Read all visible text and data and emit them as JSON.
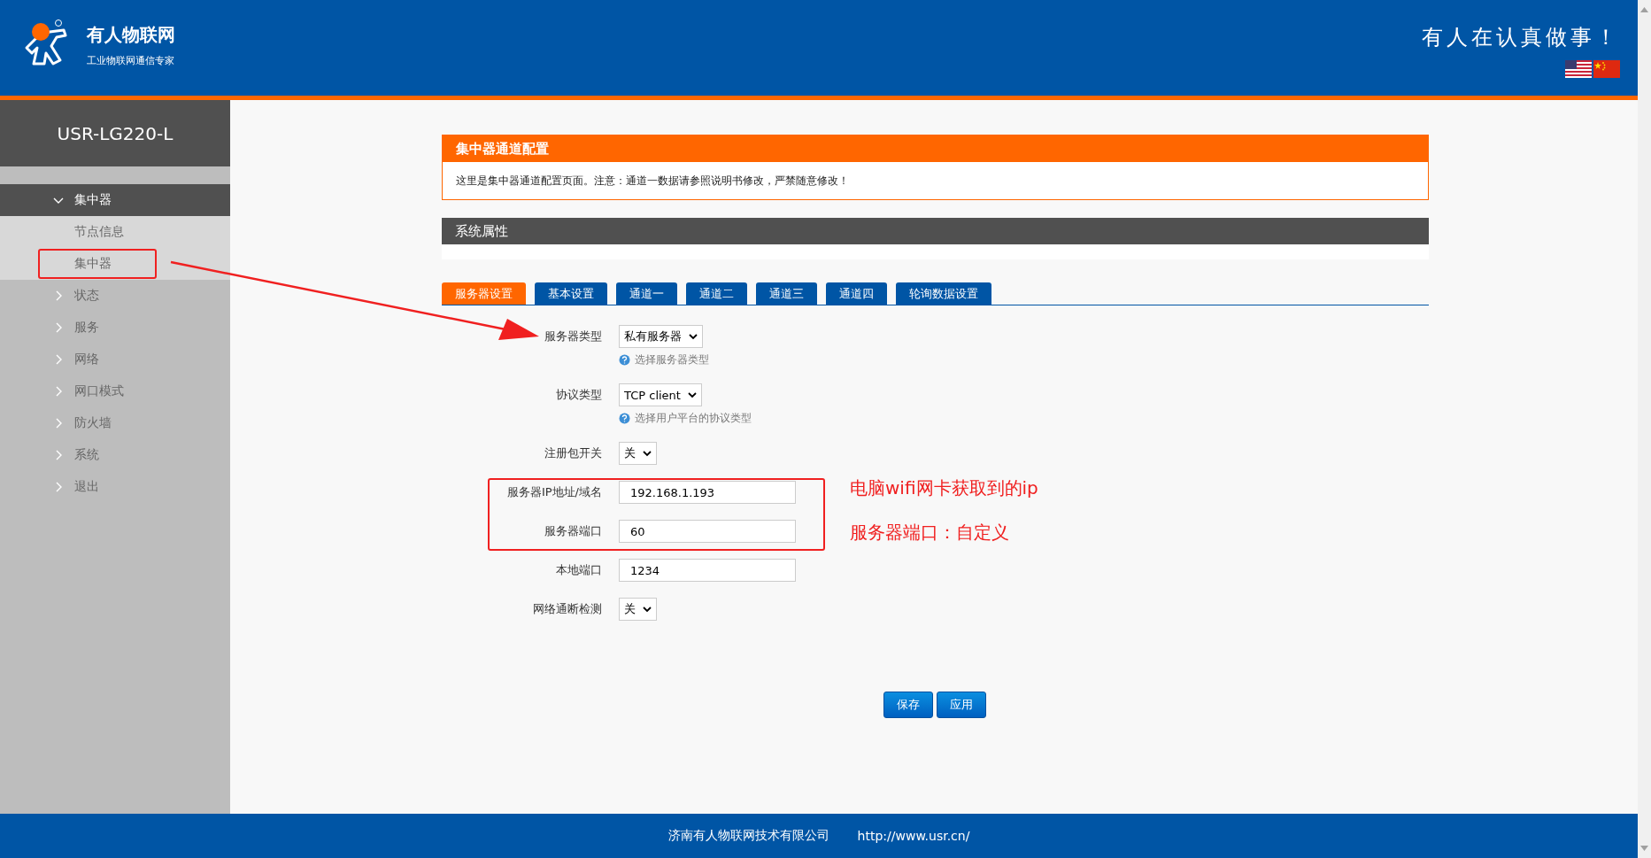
{
  "header": {
    "brand": "有人物联网",
    "tagline": "工业物联网通信专家",
    "slogan": "有人在认真做事！"
  },
  "sidebar": {
    "device": "USR-LG220-L",
    "items": [
      {
        "label": "集中器",
        "expanded": true,
        "children": [
          {
            "label": "节点信息"
          },
          {
            "label": "集中器"
          }
        ]
      },
      {
        "label": "状态",
        "expanded": false
      },
      {
        "label": "服务",
        "expanded": false
      },
      {
        "label": "网络",
        "expanded": false
      },
      {
        "label": "网口模式",
        "expanded": false
      },
      {
        "label": "防火墙",
        "expanded": false
      },
      {
        "label": "系统",
        "expanded": false
      },
      {
        "label": "退出",
        "expanded": false
      }
    ]
  },
  "notice": {
    "title": "集中器通道配置",
    "text": "这里是集中器通道配置页面。注意：通道一数据请参照说明书修改，严禁随意修改！"
  },
  "section": {
    "title": "系统属性"
  },
  "tabs": [
    {
      "label": "服务器设置",
      "selected": true
    },
    {
      "label": "基本设置",
      "selected": false
    },
    {
      "label": "通道一",
      "selected": false
    },
    {
      "label": "通道二",
      "selected": false
    },
    {
      "label": "通道三",
      "selected": false
    },
    {
      "label": "通道四",
      "selected": false
    },
    {
      "label": "轮询数据设置",
      "selected": false
    }
  ],
  "form": [
    {
      "kind": "select",
      "label": "服务器类型",
      "value": "私有服务器",
      "hint": "选择服务器类型"
    },
    {
      "kind": "select",
      "label": "协议类型",
      "value": "TCP client",
      "hint": "选择用户平台的协议类型"
    },
    {
      "kind": "select",
      "label": "注册包开关",
      "value": "关"
    },
    {
      "kind": "input",
      "label": "服务器IP地址/域名",
      "value": "192.168.1.193"
    },
    {
      "kind": "input",
      "label": "服务器端口",
      "value": "60"
    },
    {
      "kind": "input",
      "label": "本地端口",
      "value": "1234"
    },
    {
      "kind": "select",
      "label": "网络通断检测",
      "value": "关"
    }
  ],
  "buttons": [
    "保存",
    "应用"
  ],
  "annotations": [
    "电脑wifi网卡获取到的ip",
    "服务器端口：自定义"
  ],
  "footer": {
    "company": "济南有人物联网技术有限公司",
    "url": "http://www.usr.cn/"
  }
}
